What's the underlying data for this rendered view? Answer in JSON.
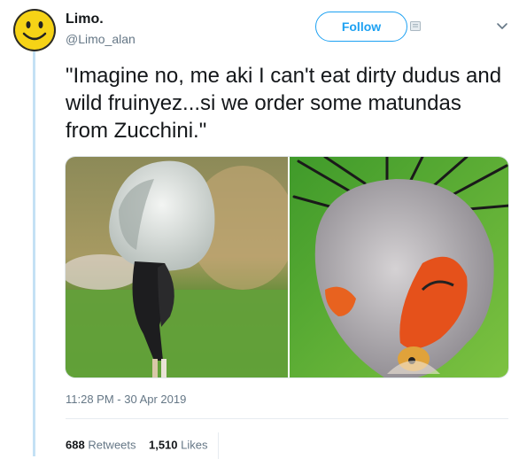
{
  "user": {
    "name": "Limo.",
    "handle": "@Limo_alan",
    "avatar_icon": "smiley-face-icon"
  },
  "actions": {
    "follow_label": "Follow",
    "follow_icon": "follow-badge-icon",
    "menu_icon": "chevron-down-icon"
  },
  "tweet": {
    "text": "\"Imagine no, me aki I can't eat dirty dudus and wild fruinyez...si we order some matundas from Zucchini.\"",
    "timestamp": "11:28 PM - 30 Apr 2019"
  },
  "stats": {
    "retweets_count": "688",
    "retweets_label": "Retweets",
    "likes_count": "1,510",
    "likes_label": "Likes"
  },
  "colors": {
    "accent": "#1da1f2",
    "thread_line": "#c4e1f5",
    "secondary_text": "#657786"
  }
}
